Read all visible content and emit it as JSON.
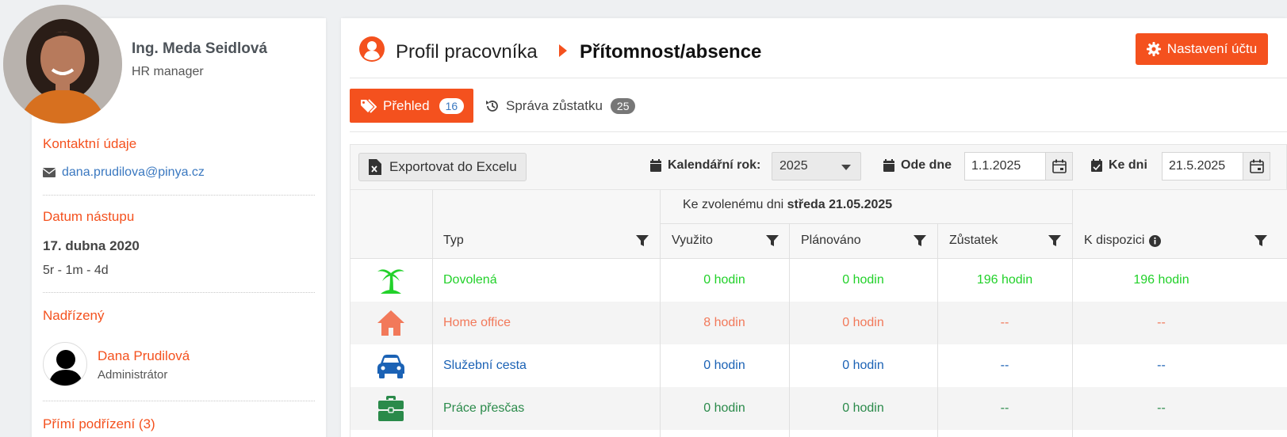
{
  "profile": {
    "name": "Ing. Meda Seidlová",
    "role": "HR manager",
    "contact_title": "Kontaktní údaje",
    "email": "dana.prudilova@pinya.cz",
    "start_title": "Datum nástupu",
    "start_date": "17. dubna 2020",
    "tenure": "5r - 1m - 4d",
    "supervisor_title": "Nadřízený",
    "supervisor_name": "Dana Prudilová",
    "supervisor_role": "Administrátor",
    "subordinates_title": "Přímí podřízení (3)"
  },
  "header": {
    "breadcrumb_profile": "Profil pracovníka",
    "breadcrumb_current": "Přítomnost/absence",
    "settings_button": "Nastavení účtu"
  },
  "tabs": [
    {
      "label": "Přehled",
      "count": "16",
      "active": true
    },
    {
      "label": "Správa zůstatku",
      "count": "25",
      "active": false
    }
  ],
  "toolbar": {
    "export_label": "Exportovat do Excelu",
    "year_label": "Kalendářní rok:",
    "year_value": "2025",
    "from_label": "Ode dne",
    "from_value": "1.1.2025",
    "to_label": "Ke dni",
    "to_value": "21.5.2025"
  },
  "table": {
    "group_prefix": "Ke zvolenému dni",
    "group_date": "středa 21.05.2025",
    "headers": {
      "type": "Typ",
      "used": "Využito",
      "planned": "Plánováno",
      "balance": "Zůstatek",
      "available": "K dispozici"
    },
    "rows": [
      {
        "type": "Dovolená",
        "icon": "palm-tree-icon",
        "color": "#22d12a",
        "used": "0 hodin",
        "planned": "0 hodin",
        "balance": "196 hodin",
        "available": "196 hodin"
      },
      {
        "type": "Home office",
        "icon": "home-icon",
        "color": "#f2795a",
        "used": "8 hodin",
        "planned": "0 hodin",
        "balance": "--",
        "available": "--"
      },
      {
        "type": "Služební cesta",
        "icon": "car-icon",
        "color": "#1b62b5",
        "used": "0 hodin",
        "planned": "0 hodin",
        "balance": "--",
        "available": "--"
      },
      {
        "type": "Práce přesčas",
        "icon": "briefcase-icon",
        "color": "#2a8a4a",
        "used": "0 hodin",
        "planned": "0 hodin",
        "balance": "--",
        "available": "--"
      }
    ]
  },
  "colors": {
    "accent": "#f4511e",
    "link": "#3a78c0"
  }
}
